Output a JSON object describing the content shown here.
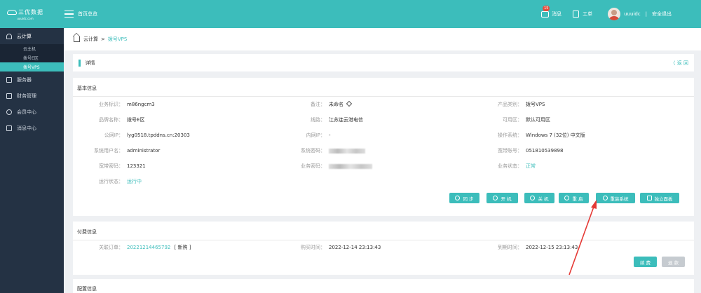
{
  "header": {
    "logo_text": "三优数据",
    "logo_sub": "uuuidc.com",
    "home_label": "首页总览",
    "msg_badge": "15",
    "msg_label": "消息",
    "ticket_label": "工单",
    "username": "uuuidc",
    "separator": "|",
    "logout_label": "安全退出"
  },
  "sidebar": {
    "items": [
      {
        "label": "云计算",
        "icon": "cloud-icon"
      },
      {
        "label": "服务器",
        "icon": "server-icon"
      },
      {
        "label": "财务管理",
        "icon": "finance-icon"
      },
      {
        "label": "会员中心",
        "icon": "user-icon"
      },
      {
        "label": "消息中心",
        "icon": "message-icon"
      }
    ],
    "sub_items": [
      {
        "label": "云主机"
      },
      {
        "label": "拨号E区"
      },
      {
        "label": "拨号VPS"
      }
    ]
  },
  "breadcrumb": {
    "root": "云计算",
    "sep": ">",
    "current": "拨号VPS"
  },
  "detail": {
    "title": "详情",
    "back": "〈 返 回"
  },
  "basic": {
    "title": "基本信息",
    "fields": [
      {
        "label": "业务标识：",
        "value": "m86ngcm3"
      },
      {
        "label": "备注：",
        "value": "未命名"
      },
      {
        "label": "产品类别：",
        "value": "拨号VPS"
      },
      {
        "label": "品牌名称：",
        "value": "拨号E区"
      },
      {
        "label": "线路：",
        "value": "江苏连云港电信"
      },
      {
        "label": "可用区：",
        "value": "默认可用区"
      },
      {
        "label": "公网IP：",
        "value": "lyg0518.tpddns.cn:20303"
      },
      {
        "label": "内网IP：",
        "value": "-"
      },
      {
        "label": "操作系统：",
        "value": "Windows 7 (32位) 中文版"
      },
      {
        "label": "系统用户名：",
        "value": "administrator"
      },
      {
        "label": "系统密码：",
        "value": ""
      },
      {
        "label": "宽带账号：",
        "value": "051810539898"
      },
      {
        "label": "宽带密码：",
        "value": "123321"
      },
      {
        "label": "业务密码：",
        "value": ""
      },
      {
        "label": "业务状态：",
        "value": "正常"
      },
      {
        "label": "运行状态：",
        "value": "运行中"
      }
    ],
    "buttons": [
      {
        "label": "同 步",
        "icon": "sync-icon"
      },
      {
        "label": "开 机",
        "icon": "power-on-icon"
      },
      {
        "label": "关 机",
        "icon": "power-off-icon"
      },
      {
        "label": "重 启",
        "icon": "restart-icon"
      },
      {
        "label": "重装系统",
        "icon": "reinstall-icon"
      },
      {
        "label": "独立面板",
        "icon": "panel-icon"
      }
    ]
  },
  "payment": {
    "title": "付费信息",
    "order_label": "关联订单：",
    "order_value": "20221214465792",
    "order_tag": "[ 新购 ]",
    "buy_label": "购买时间：",
    "buy_value": "2022-12-14 23:13:43",
    "expire_label": "到期时间：",
    "expire_value": "2022-12-15 23:13:43",
    "renew_label": "续 费",
    "refund_label": "退 款"
  },
  "config": {
    "title": "配置信息"
  },
  "colors": {
    "accent": "#3cbdbb",
    "sidebar": "#243244",
    "annotation_arrow": "#e53935"
  }
}
